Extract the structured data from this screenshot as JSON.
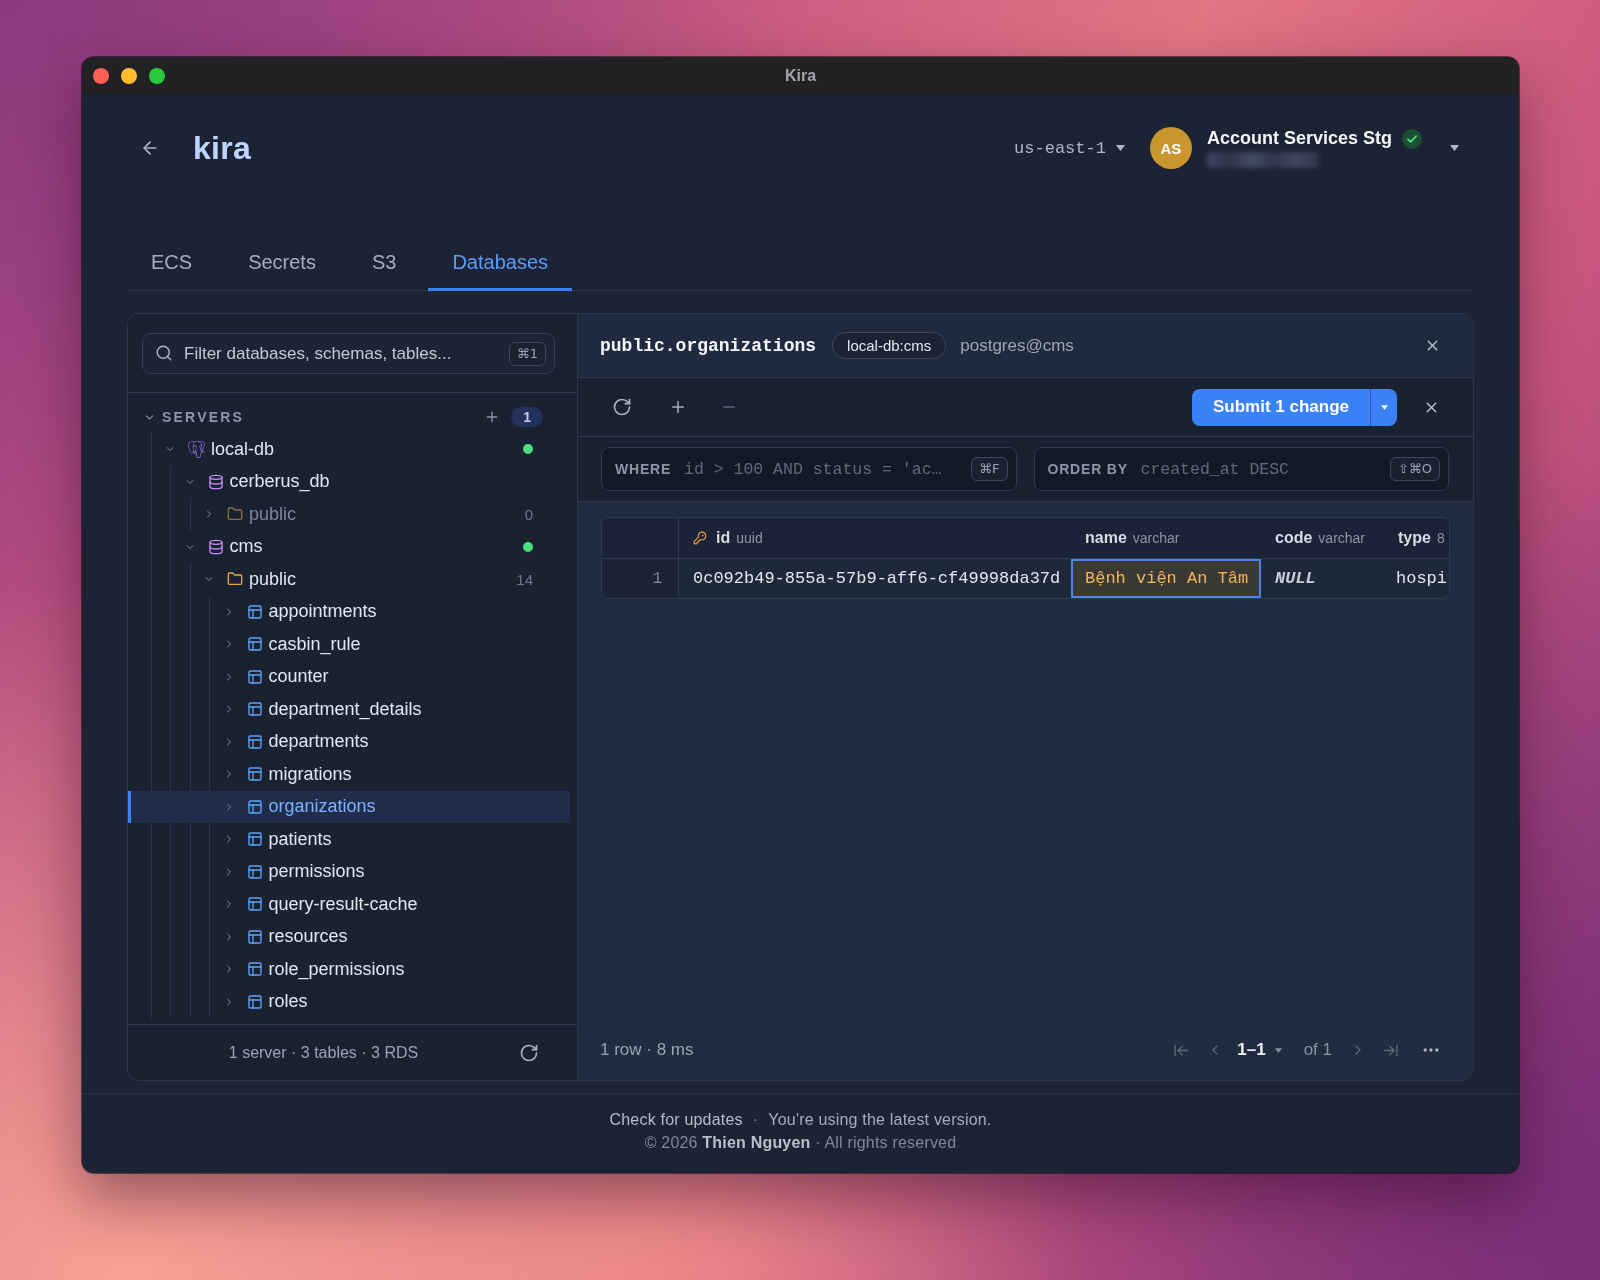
{
  "window": {
    "title": "Kira"
  },
  "header": {
    "app_name": "kira",
    "region": "us-east-1",
    "account": {
      "initials": "AS",
      "name": "Account Services Stg",
      "verified": true
    }
  },
  "tabs": [
    {
      "label": "ECS",
      "selected": false
    },
    {
      "label": "Secrets",
      "selected": false
    },
    {
      "label": "S3",
      "selected": false
    },
    {
      "label": "Databases",
      "selected": true
    }
  ],
  "sidebar": {
    "search": {
      "placeholder": "Filter databases, schemas, tables...",
      "shortcut": "⌘1"
    },
    "section": {
      "label": "SERVERS",
      "expanded": true,
      "count": "1"
    },
    "tree": [
      {
        "kind": "server",
        "label": "local-db",
        "expanded": true,
        "selected": false,
        "connected": true,
        "children": [
          {
            "kind": "database",
            "label": "cerberus_db",
            "expanded": true,
            "selected": false,
            "connected": false,
            "children": [
              {
                "kind": "schema",
                "label": "public",
                "expanded": false,
                "selected": false,
                "disabled": true,
                "count": "0"
              }
            ]
          },
          {
            "kind": "database",
            "label": "cms",
            "expanded": true,
            "selected": false,
            "connected": true,
            "children": [
              {
                "kind": "schema",
                "label": "public",
                "expanded": true,
                "selected": false,
                "disabled": false,
                "count": "14",
                "children": [
                  {
                    "kind": "table",
                    "label": "appointments",
                    "expanded": false,
                    "selected": false
                  },
                  {
                    "kind": "table",
                    "label": "casbin_rule",
                    "expanded": false,
                    "selected": false
                  },
                  {
                    "kind": "table",
                    "label": "counter",
                    "expanded": false,
                    "selected": false
                  },
                  {
                    "kind": "table",
                    "label": "department_details",
                    "expanded": false,
                    "selected": false
                  },
                  {
                    "kind": "table",
                    "label": "departments",
                    "expanded": false,
                    "selected": false
                  },
                  {
                    "kind": "table",
                    "label": "migrations",
                    "expanded": false,
                    "selected": false
                  },
                  {
                    "kind": "table",
                    "label": "organizations",
                    "expanded": false,
                    "selected": true
                  },
                  {
                    "kind": "table",
                    "label": "patients",
                    "expanded": false,
                    "selected": false
                  },
                  {
                    "kind": "table",
                    "label": "permissions",
                    "expanded": false,
                    "selected": false
                  },
                  {
                    "kind": "table",
                    "label": "query-result-cache",
                    "expanded": false,
                    "selected": false
                  },
                  {
                    "kind": "table",
                    "label": "resources",
                    "expanded": false,
                    "selected": false
                  },
                  {
                    "kind": "table",
                    "label": "role_permissions",
                    "expanded": false,
                    "selected": false
                  },
                  {
                    "kind": "table",
                    "label": "roles",
                    "expanded": false,
                    "selected": false
                  }
                ]
              }
            ]
          }
        ]
      }
    ],
    "footer": "1 server · 3 tables · 3 RDS"
  },
  "table_view": {
    "title": "public.organizations",
    "connection": "local-db:cms",
    "user": "postgres@cms",
    "submit_label": "Submit 1 change",
    "filters": [
      {
        "label": "WHERE",
        "placeholder": "id > 100 AND status = 'ac…",
        "shortcut": "⌘F"
      },
      {
        "label": "ORDER BY",
        "placeholder": "created_at DESC",
        "shortcut": "⇧⌘O"
      }
    ],
    "columns": [
      {
        "name": "id",
        "type": "uuid",
        "primary_key": true
      },
      {
        "name": "name",
        "type": "varchar",
        "primary_key": false
      },
      {
        "name": "code",
        "type": "varchar",
        "primary_key": false
      },
      {
        "name": "type",
        "type": "8",
        "primary_key": false
      }
    ],
    "rows": [
      {
        "number": "1",
        "cells": [
          {
            "value": "0c092b49-855a-57b9-aff6-cf49998da37d",
            "edited": false,
            "is_null": false
          },
          {
            "value": "Bệnh viện An Tâm",
            "edited": true,
            "is_null": false
          },
          {
            "value": "NULL",
            "edited": false,
            "is_null": true
          },
          {
            "value": "hospi",
            "edited": false,
            "is_null": false
          }
        ]
      }
    ],
    "status": "1 row · 8 ms",
    "pagination": {
      "range": "1–1",
      "total": "of 1"
    }
  },
  "app_footer": {
    "update_link": "Check for updates",
    "separator": "·",
    "update_status": "You're using the latest version.",
    "copyright": "© 2026 **Thien Nguyen** · All rights reserved"
  }
}
